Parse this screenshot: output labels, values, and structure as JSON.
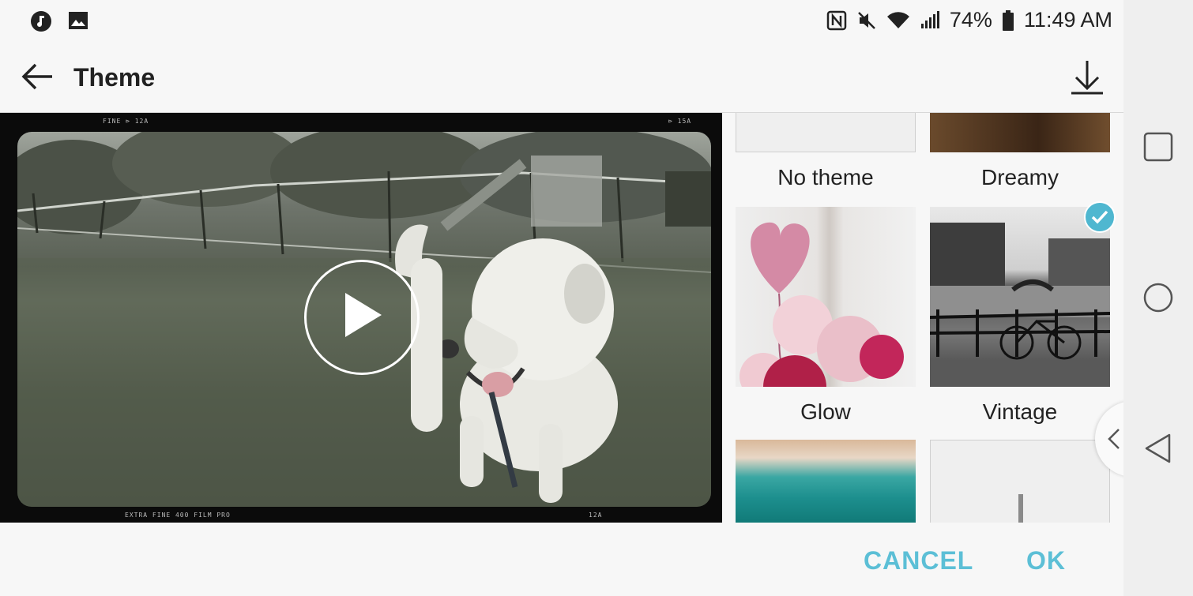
{
  "status_bar": {
    "battery": "74%",
    "time": "11:49 AM"
  },
  "toolbar": {
    "title": "Theme"
  },
  "preview": {
    "film_top_left": "FINE ⊳ 12A",
    "film_top_right": "⊳ 15A",
    "film_bottom_left": "EXTRA FINE 400 FILM PRO",
    "film_bottom_right": "12A"
  },
  "themes": [
    {
      "label": "No theme",
      "selected": false
    },
    {
      "label": "Dreamy",
      "selected": false
    },
    {
      "label": "Glow",
      "selected": false
    },
    {
      "label": "Vintage",
      "selected": true
    }
  ],
  "actions": {
    "cancel": "CANCEL",
    "ok": "OK"
  },
  "colors": {
    "accent": "#5cbfd6",
    "check": "#4fb7d0"
  }
}
